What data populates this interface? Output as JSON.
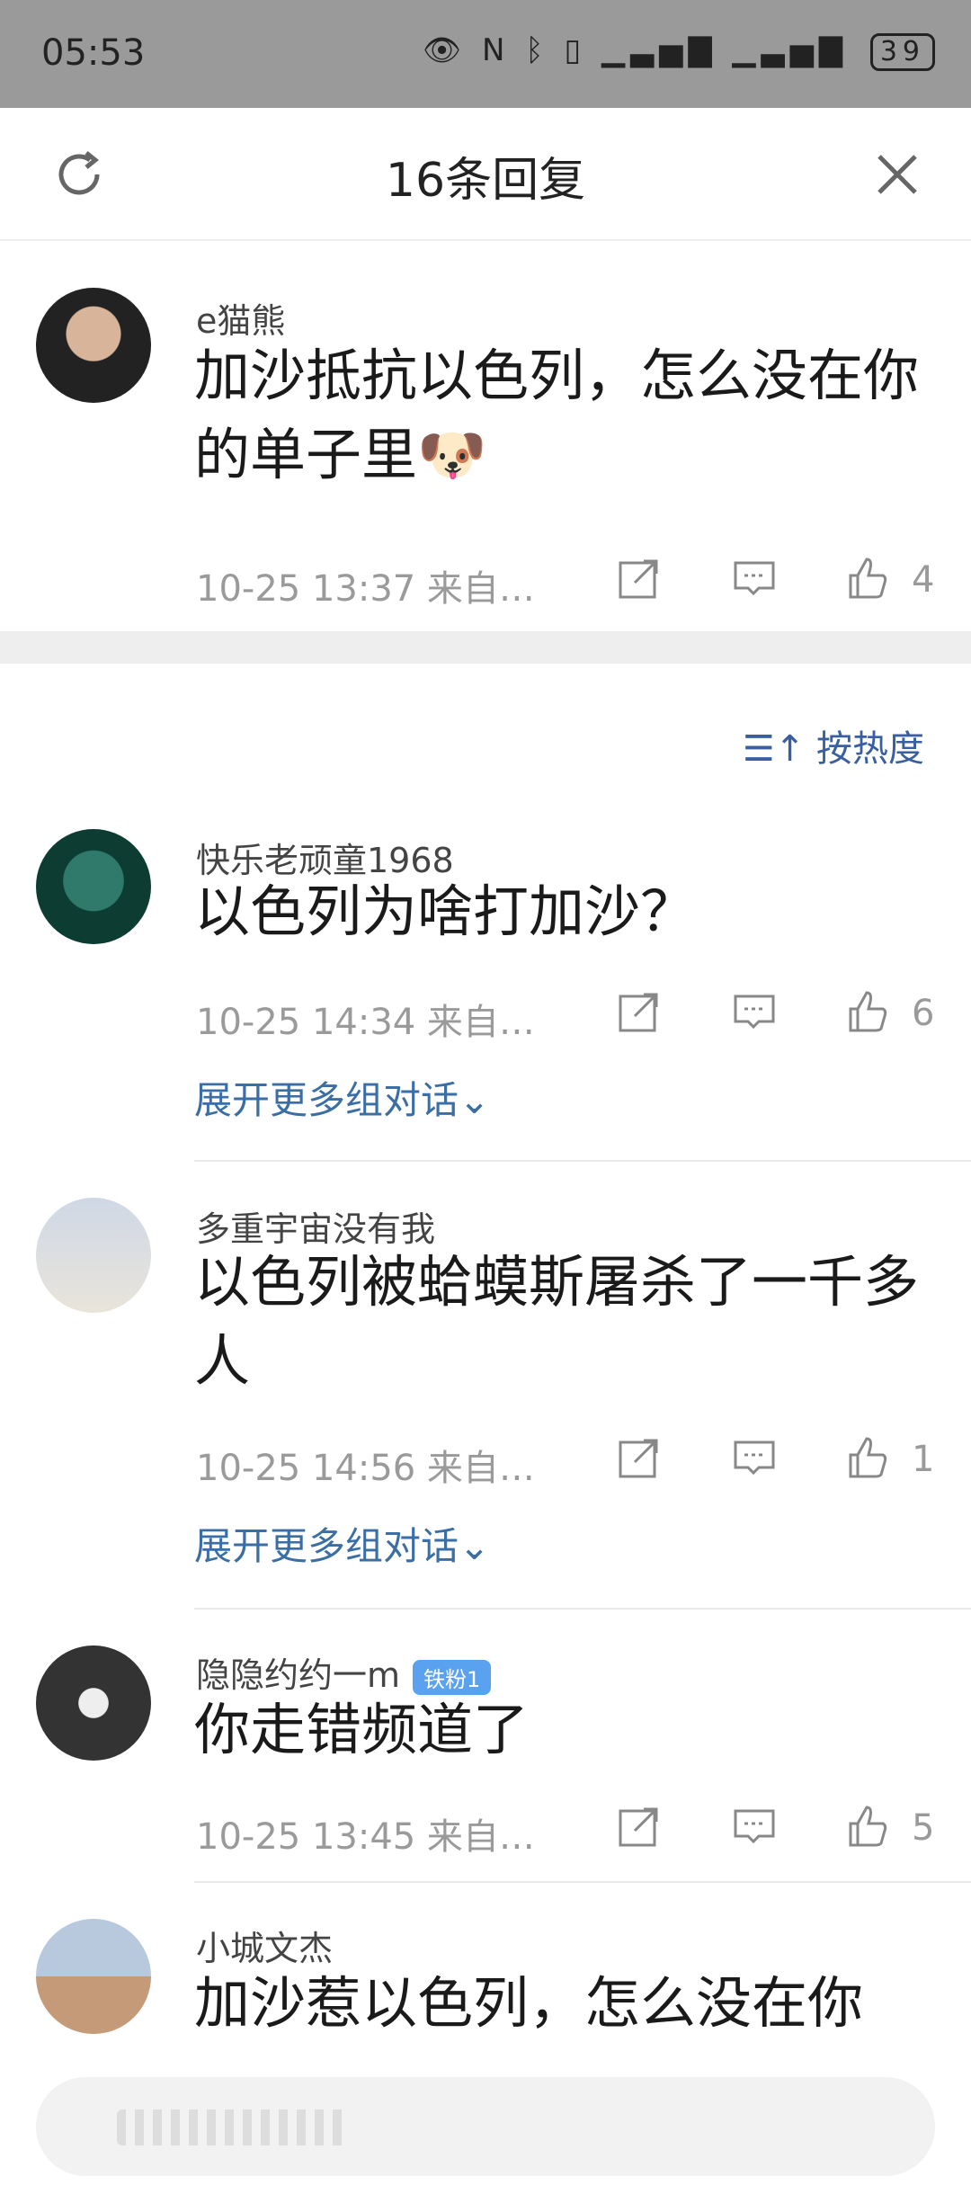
{
  "status_bar": {
    "time": "05:53",
    "battery": "39"
  },
  "header": {
    "title": "16条回复"
  },
  "root_comment": {
    "user": "e猫熊",
    "text": "加沙抵抗以色列，怎么没在你的单子里",
    "emoji": "🐶",
    "time": "10-25 13:37 来自…",
    "likes": "4"
  },
  "sort": {
    "label": "按热度",
    "icon": "sort-icon"
  },
  "replies": [
    {
      "user": "快乐老顽童1968",
      "text": "以色列为啥打加沙？",
      "time": "10-25 14:34 来自…",
      "likes": "6",
      "expand": "展开更多组对话⌄"
    },
    {
      "user": "多重宇宙没有我",
      "text": "以色列被蛤蟆斯屠杀了一千多人",
      "time": "10-25 14:56 来自…",
      "likes": "1",
      "expand": "展开更多组对话⌄"
    },
    {
      "user": "隐隐约约一m",
      "badge": "铁粉1",
      "text": "你走错频道了",
      "time": "10-25 13:45 来自…",
      "likes": "5"
    },
    {
      "user": "小城文杰",
      "text": "加沙惹以色列，怎么没在你"
    }
  ],
  "colors": {
    "link": "#3a6ea5",
    "badge": "#5aa2f0",
    "statusbar": "#9a9a9a"
  }
}
